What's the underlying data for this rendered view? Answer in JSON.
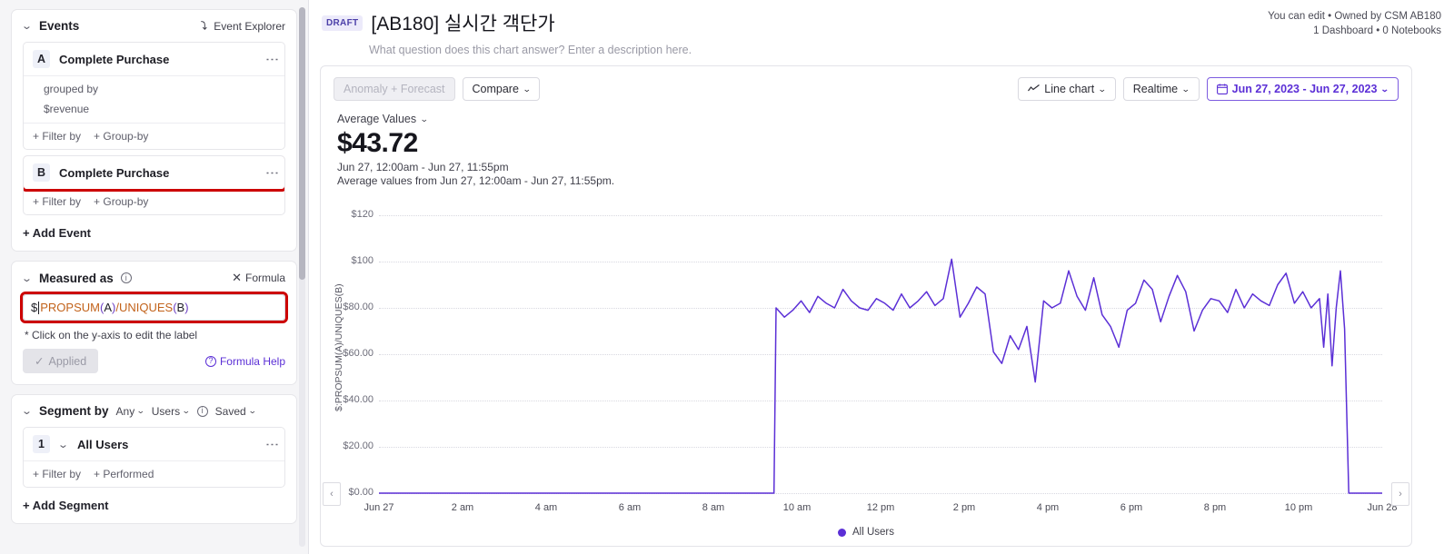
{
  "sidebar": {
    "events": {
      "title": "Events",
      "explorer_label": "Event Explorer",
      "explorer_icon": "event-explorer-icon",
      "add_label": "+ Add Event",
      "items": [
        {
          "badge": "A",
          "label": "Complete Purchase",
          "grouped_by_label": "grouped by",
          "grouped_by_value": "$revenue",
          "filter_label": "+ Filter by",
          "group_label": "+ Group-by",
          "highlighted": false
        },
        {
          "badge": "B",
          "label": "Complete Purchase",
          "filter_label": "+ Filter by",
          "group_label": "+ Group-by",
          "highlighted": true
        }
      ]
    },
    "measured_as": {
      "title": "Measured as",
      "info_icon": "info-icon",
      "formula_toggle": "Formula",
      "formula_toggle_icon": "close-icon",
      "formula_prefix": "$",
      "formula_tokens": [
        {
          "text": "PROPSUM",
          "kind": "fn"
        },
        {
          "text": "(",
          "kind": "paren"
        },
        {
          "text": "A",
          "kind": "plain"
        },
        {
          "text": ")",
          "kind": "paren"
        },
        {
          "text": "/",
          "kind": "fn"
        },
        {
          "text": "UNIQUES",
          "kind": "fn"
        },
        {
          "text": "(",
          "kind": "paren"
        },
        {
          "text": "B",
          "kind": "plain"
        },
        {
          "text": ")",
          "kind": "paren"
        }
      ],
      "formula_value": "$PROPSUM(A)/UNIQUES(B)",
      "note": "* Click on the y-axis to edit the label",
      "applied_label": "Applied",
      "applied_icon": "check-icon",
      "help_label": "Formula Help",
      "help_icon": "question-icon",
      "highlighted": true
    },
    "segment_by": {
      "title": "Segment by",
      "any_label": "Any",
      "users_label": "Users",
      "info_icon": "info-icon",
      "saved_label": "Saved",
      "add_label": "+ Add Segment",
      "items": [
        {
          "badge": "1",
          "label": "All Users",
          "filter_label": "+ Filter by",
          "performed_label": "+ Performed"
        }
      ]
    }
  },
  "header": {
    "status_badge": "DRAFT",
    "title": "[AB180] 실시간 객단가",
    "description_placeholder": "What question does this chart answer? Enter a description here.",
    "meta_line_1": "You can edit • Owned by CSM AB180",
    "meta_line_2": "1 Dashboard • 0 Notebooks"
  },
  "toolbar": {
    "anomaly_label": "Anomaly + Forecast",
    "compare_label": "Compare",
    "chart_type_label": "Line chart",
    "chart_type_icon": "line-chart-icon",
    "realtime_label": "Realtime",
    "date_range_label": "Jun 27, 2023 - Jun 27, 2023",
    "date_range_icon": "calendar-icon"
  },
  "summary": {
    "aggregation_label": "Average Values",
    "value": "$43.72",
    "range_line": "Jun 27, 12:00am - Jun 27, 11:55pm",
    "description_line": "Average values from Jun 27, 12:00am - Jun 27, 11:55pm."
  },
  "plot": {
    "prev_arrow": "‹",
    "next_arrow": "›",
    "legend": [
      {
        "label": "All Users",
        "color": "#5b2fd6"
      }
    ]
  },
  "chart_data": {
    "type": "line",
    "title": "[AB180] 실시간 객단가",
    "xlabel": "",
    "ylabel": "$:PROPSUM(A)/UNIQUES(B)",
    "ylim": [
      0,
      120
    ],
    "yticks": [
      0,
      20,
      40,
      60,
      80,
      100,
      120
    ],
    "ytick_labels": [
      "$0.00",
      "$20.00",
      "$40.00",
      "$60.00",
      "$80.00",
      "$100",
      "$120"
    ],
    "xtick_labels": [
      "Jun 27",
      "2 am",
      "4 am",
      "6 am",
      "8 am",
      "10 am",
      "12 pm",
      "2 pm",
      "4 pm",
      "6 pm",
      "8 pm",
      "10 pm",
      "Jun 28"
    ],
    "grid": true,
    "legend_position": "bottom",
    "line_color": "#5b2fd6",
    "series": [
      {
        "name": "All Users",
        "x": [
          0.0,
          0.4,
          0.8,
          1.2,
          1.6,
          2.0,
          2.4,
          2.8,
          3.2,
          3.6,
          4.0,
          4.4,
          4.8,
          5.2,
          5.6,
          6.0,
          6.4,
          6.8,
          7.2,
          7.6,
          8.0,
          8.4,
          8.8,
          9.2,
          9.45,
          9.5,
          9.7,
          9.9,
          10.1,
          10.3,
          10.5,
          10.7,
          10.9,
          11.1,
          11.3,
          11.5,
          11.7,
          11.9,
          12.1,
          12.3,
          12.5,
          12.7,
          12.9,
          13.1,
          13.3,
          13.5,
          13.7,
          13.9,
          14.1,
          14.3,
          14.5,
          14.7,
          14.9,
          15.1,
          15.3,
          15.5,
          15.7,
          15.9,
          16.1,
          16.3,
          16.5,
          16.7,
          16.9,
          17.1,
          17.3,
          17.5,
          17.7,
          17.9,
          18.1,
          18.3,
          18.5,
          18.7,
          18.9,
          19.1,
          19.3,
          19.5,
          19.7,
          19.9,
          20.1,
          20.3,
          20.5,
          20.7,
          20.9,
          21.1,
          21.3,
          21.5,
          21.7,
          21.9,
          22.1,
          22.3,
          22.5,
          22.6,
          22.7,
          22.8,
          22.9,
          23.0,
          23.1,
          23.2,
          23.4,
          24.0
        ],
        "y": [
          0,
          0,
          0,
          0,
          0,
          0,
          0,
          0,
          0,
          0,
          0,
          0,
          0,
          0,
          0,
          0,
          0,
          0,
          0,
          0,
          0,
          0,
          0,
          0,
          0,
          80,
          76,
          79,
          83,
          78,
          85,
          82,
          80,
          88,
          83,
          80,
          79,
          84,
          82,
          79,
          86,
          80,
          83,
          87,
          81,
          84,
          101,
          76,
          82,
          89,
          86,
          61,
          56,
          68,
          62,
          72,
          48,
          83,
          80,
          82,
          96,
          85,
          79,
          93,
          77,
          72,
          63,
          79,
          82,
          92,
          88,
          74,
          85,
          94,
          87,
          70,
          79,
          84,
          83,
          78,
          88,
          80,
          86,
          83,
          81,
          90,
          95,
          82,
          87,
          80,
          84,
          63,
          86,
          55,
          80,
          96,
          71,
          0,
          0,
          0
        ]
      }
    ]
  }
}
